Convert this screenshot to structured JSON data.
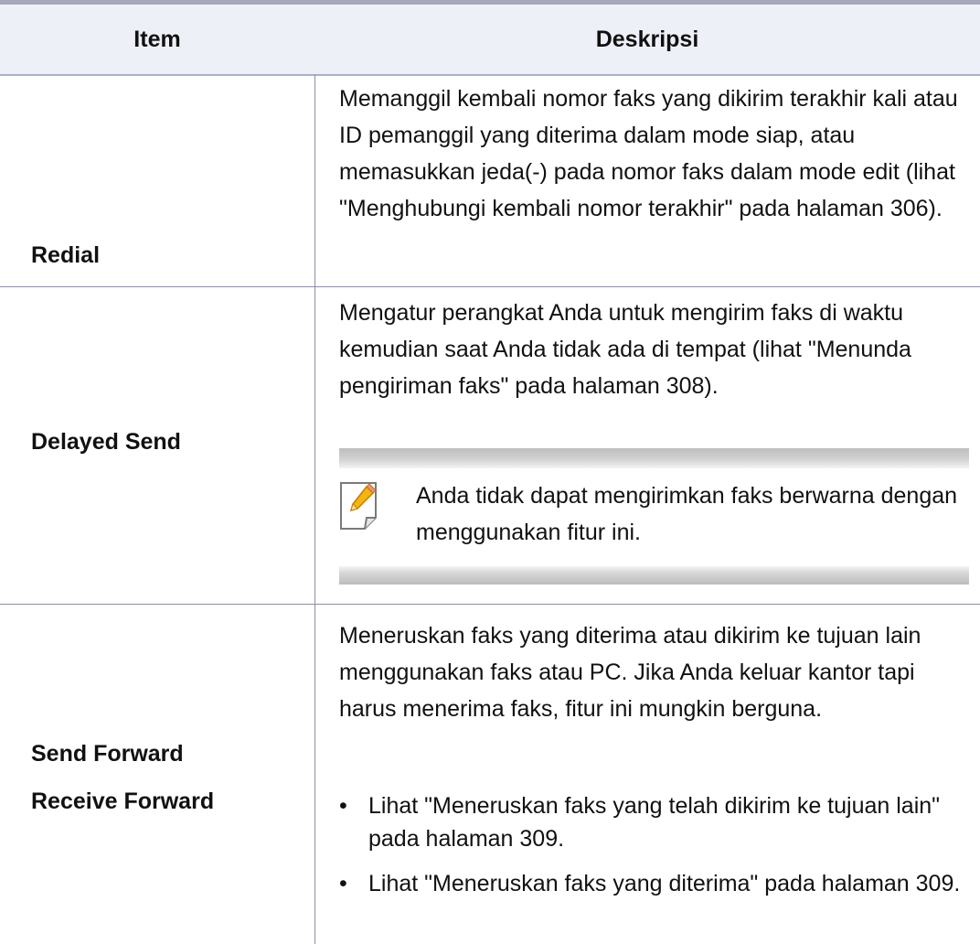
{
  "table": {
    "headers": {
      "item": "Item",
      "description": "Deskripsi"
    },
    "rows": [
      {
        "items": [
          "Redial"
        ],
        "description": "Memanggil kembali nomor faks yang dikirim terakhir kali atau ID pemanggil yang diterima dalam mode siap, atau memasukkan jeda(-) pada nomor faks dalam mode edit (lihat \"Menghubungi kembali nomor terakhir\" pada halaman 306)."
      },
      {
        "items": [
          "Delayed Send"
        ],
        "description": "Mengatur perangkat Anda untuk mengirim faks di waktu kemudian saat Anda tidak ada di tempat (lihat \"Menunda pengiriman faks\" pada halaman 308).",
        "note": {
          "icon": "note-pencil-icon",
          "text": "Anda tidak dapat mengirimkan faks berwarna dengan menggunakan fitur ini."
        }
      },
      {
        "items": [
          "Send Forward",
          "Receive Forward"
        ],
        "description": "Meneruskan faks yang diterima atau dikirim ke tujuan lain menggunakan faks atau PC. Jika Anda keluar kantor tapi harus menerima faks, fitur ini mungkin berguna.",
        "bullets": [
          "Lihat \"Meneruskan faks yang telah dikirim ke tujuan lain\" pada halaman 309.",
          "Lihat \"Meneruskan faks yang diterima\" pada halaman 309."
        ]
      }
    ]
  },
  "bullet_glyph": "•"
}
